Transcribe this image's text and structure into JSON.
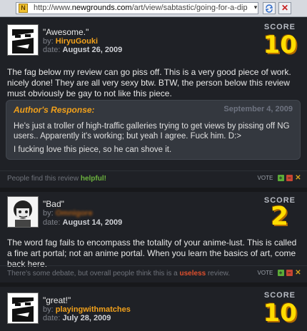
{
  "browser": {
    "url_prefix": "http://www.",
    "url_host": "newgrounds.com",
    "url_path": "/art/view/sabtastic/going-for-a-dip"
  },
  "reviews": [
    {
      "title": "\"Awesome.\"",
      "by_label": "by:",
      "user": "HiryuGouki",
      "date_label": "date:",
      "date": "August 26, 2009",
      "score_label": "SCORE",
      "score": "10",
      "body": "The fag below my review can go piss off. This is a very good piece of work. nicely done! They are all very sexy btw. BTW, the person below this review must obviously be gay to not like this piece.",
      "response": {
        "heading": "Author's Response:",
        "date": "September 4, 2009",
        "p1": "He's just a troller of high-traffic galleries trying to get views by pissing off NG users.. Apparently it's working; but yeah I agree. Fuck him. D:>",
        "p2": "I fucking love this piece, so he can shove it."
      },
      "footer_prefix": "People find this review ",
      "footer_status": "helpful!",
      "footer_suffix": "",
      "vote_label": "VOTE"
    },
    {
      "title": "\"Bad\"",
      "by_label": "by:",
      "user": "Omnigore",
      "date_label": "date:",
      "date": "August 14, 2009",
      "score_label": "SCORE",
      "score": "2",
      "body": "The word fag fails to encompass the totality of your anime-lust. This is called a fine art portal; not an anime portal. When you learn the basics of art, come back here.",
      "footer_prefix": "There's some debate, but overall people think this is a ",
      "footer_status": "useless",
      "footer_suffix": " review.",
      "vote_label": "VOTE"
    },
    {
      "title": "\"great!\"",
      "by_label": "by:",
      "user": "playingwithmatches",
      "date_label": "date:",
      "date": "July 28, 2009",
      "score_label": "SCORE",
      "score": "10"
    }
  ]
}
